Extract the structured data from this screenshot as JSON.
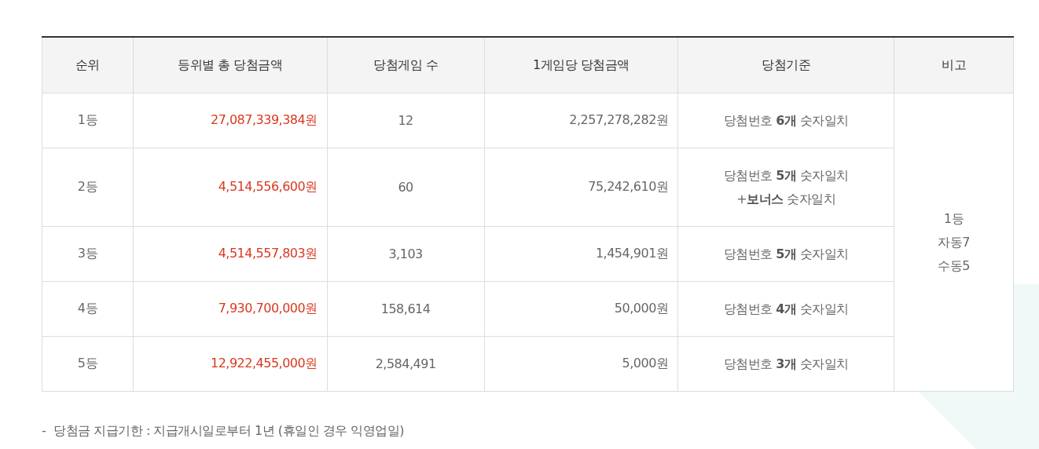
{
  "table": {
    "columns": [
      "순위",
      "등위별 총 당첨금액",
      "당첨게임 수",
      "1게임당 당첨금액",
      "당첨기준",
      "비고"
    ],
    "rows": [
      {
        "rank": "1등",
        "total": "27,087,339,384원",
        "games": "12",
        "per_game": "2,257,278,282원",
        "criteria": [
          "당첨번호 **6개** 숫자일치"
        ]
      },
      {
        "rank": "2등",
        "total": "4,514,556,600원",
        "games": "60",
        "per_game": "75,242,610원",
        "criteria": [
          "당첨번호 **5개** 숫자일치",
          "+**보너스** 숫자일치"
        ]
      },
      {
        "rank": "3등",
        "total": "4,514,557,803원",
        "games": "3,103",
        "per_game": "1,454,901원",
        "criteria": [
          "당첨번호 **5개** 숫자일치"
        ]
      },
      {
        "rank": "4등",
        "total": "7,930,700,000원",
        "games": "158,614",
        "per_game": "50,000원",
        "criteria": [
          "당첨번호 **4개** 숫자일치"
        ]
      },
      {
        "rank": "5등",
        "total": "12,922,455,000원",
        "games": "2,584,491",
        "per_game": "5,000원",
        "criteria": [
          "당첨번호 **3개** 숫자일치"
        ]
      }
    ],
    "remark": [
      "1등",
      "자동7",
      "수동5"
    ]
  },
  "note": {
    "bullet": "-",
    "text": "당첨금 지급기한 : 지급개시일로부터 1년 (휴일인 경우 익영업일)"
  }
}
